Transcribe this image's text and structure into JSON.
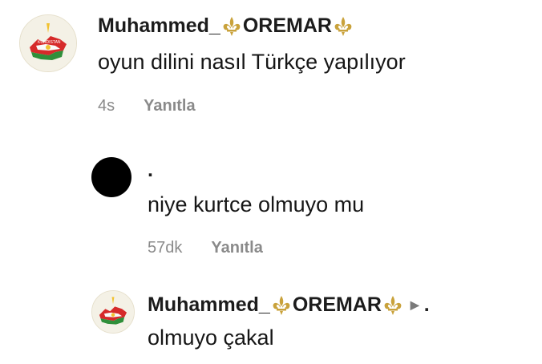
{
  "comments": [
    {
      "username_prefix": "Muhammed_",
      "username_core": "OREMAR",
      "avatar_text": "KURDISTAN",
      "text": "oyun dilini nasıl Türkçe yapılıyor",
      "time": "4s",
      "reply_label": "Yanıtla"
    },
    {
      "username": ".",
      "text": "niye kurtce olmuyo mu",
      "time": "57dk",
      "reply_label": "Yanıtla"
    },
    {
      "username_prefix": "Muhammed_",
      "username_core": "OREMAR",
      "reply_to": ".",
      "text": "olmuyo çakal"
    }
  ],
  "colors": {
    "fleur": "#c9a23b",
    "flag_red": "#d62a2a",
    "flag_green": "#2f8f3a",
    "flag_sun": "#f2c230",
    "meta_gray": "#8a8a8a"
  }
}
